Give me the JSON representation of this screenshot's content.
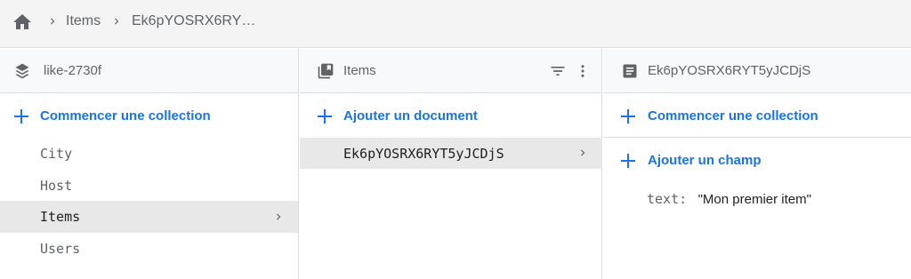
{
  "breadcrumb": {
    "home_icon": "home-icon",
    "items": [
      "Items",
      "Ek6pYOSRX6RY…"
    ]
  },
  "columns": {
    "root": {
      "title": "like-2730f",
      "icon": "firestore-icon",
      "add_label": "Commencer une collection",
      "collections": [
        "City",
        "Host",
        "Items",
        "Users"
      ],
      "selected": "Items"
    },
    "collection": {
      "title": "Items",
      "icon": "collection-icon",
      "add_label": "Ajouter un document",
      "documents": [
        "Ek6pYOSRX6RYT5yJCDjS"
      ]
    },
    "document": {
      "title": "Ek6pYOSRX6RYT5yJCDjS",
      "icon": "document-icon",
      "add_collection_label": "Commencer une collection",
      "add_field_label": "Ajouter un champ",
      "fields": [
        {
          "key": "text:",
          "value": "\"Mon premier item\""
        }
      ]
    }
  },
  "colors": {
    "accent": "#1a73e8",
    "header_bg": "#f8f9fa",
    "selected_bg": "#e8e8e8",
    "border": "#dadce0"
  }
}
